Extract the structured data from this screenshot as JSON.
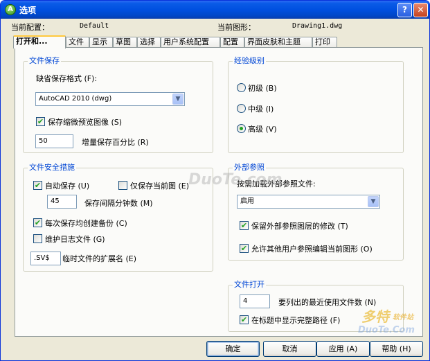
{
  "window": {
    "title": "选项",
    "help_glyph": "?",
    "close_glyph": "✕",
    "app_icon_glyph": "A"
  },
  "profile": {
    "current_profile_label": "当前配置：",
    "current_profile_value": "Default",
    "current_drawing_label": "当前图形：",
    "current_drawing_value": "Drawing1.dwg"
  },
  "tabs": [
    {
      "label": "打开和..."
    },
    {
      "label": "文件"
    },
    {
      "label": "显示"
    },
    {
      "label": "草图"
    },
    {
      "label": "选择"
    },
    {
      "label": "用户系统配置"
    },
    {
      "label": "配置"
    },
    {
      "label": "界面皮肤和主题"
    },
    {
      "label": "打印"
    }
  ],
  "file_save": {
    "legend": "文件保存",
    "format_label": "缺省保存格式 (F):",
    "format_value": "AutoCAD 2010 (dwg)",
    "thumbnail_label": "保存缩微预览图像 (S)",
    "thumbnail_checked": true,
    "incremental_value": "50",
    "incremental_label": "增量保存百分比 (R)"
  },
  "experience": {
    "legend": "经验级别",
    "options": [
      {
        "label": "初级 (B)",
        "selected": false
      },
      {
        "label": "中级 (I)",
        "selected": false
      },
      {
        "label": "高级 (V)",
        "selected": true
      }
    ]
  },
  "file_safety": {
    "legend": "文件安全措施",
    "autosave_label": "自动保存 (U)",
    "autosave_checked": true,
    "current_only_label": "仅保存当前图 (E)",
    "current_only_checked": false,
    "interval_value": "45",
    "interval_label": "保存间隔分钟数 (M)",
    "backup_label": "每次保存均创建备份 (C)",
    "backup_checked": true,
    "log_label": "维护日志文件 (G)",
    "log_checked": false,
    "ext_value": ".SV$",
    "ext_label": "临时文件的扩展名 (E)"
  },
  "xref": {
    "legend": "外部参照",
    "demand_label": "按需加载外部参照文件:",
    "demand_value": "启用",
    "retain_label": "保留外部参照图层的修改 (T)",
    "retain_checked": true,
    "allow_label": "允许其他用户参照编辑当前图形 (O)",
    "allow_checked": true
  },
  "file_open": {
    "legend": "文件打开",
    "recent_value": "4",
    "recent_label": "要列出的最近使用文件数 (N)",
    "fullpath_label": "在标题中显示完整路径 (F)",
    "fullpath_checked": true
  },
  "buttons": {
    "ok": "确定",
    "cancel": "取消",
    "apply": "应用 (A)",
    "help": "帮助 (H)"
  },
  "watermark": {
    "text1": "DuoTe.com",
    "text2": "多特",
    "text3": "软件站",
    "text4": "DuoTe.Com"
  },
  "glyphs": {
    "check": "✔",
    "dropdown_arrow": "▼"
  }
}
